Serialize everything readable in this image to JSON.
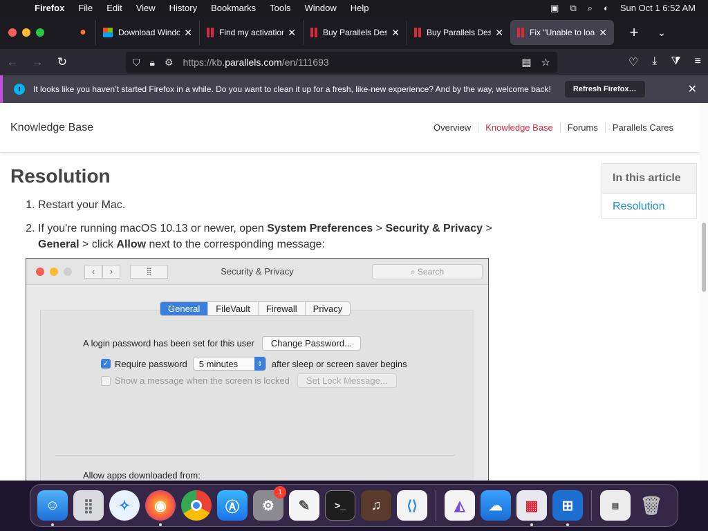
{
  "menubar": {
    "app": "Firefox",
    "items": [
      "File",
      "Edit",
      "View",
      "History",
      "Bookmarks",
      "Tools",
      "Window",
      "Help"
    ],
    "clock": "Sun Oct 1  6:52 AM"
  },
  "tabs": [
    {
      "label": "Download Windows",
      "icon": "microsoft-icon"
    },
    {
      "label": "Find my activation",
      "icon": "parallels-icon"
    },
    {
      "label": "Buy Parallels Desktop",
      "icon": "parallels-icon"
    },
    {
      "label": "Buy Parallels Desktop",
      "icon": "parallels-icon"
    },
    {
      "label": "Fix \"Unable to load",
      "icon": "parallels-icon",
      "active": true
    }
  ],
  "urlbar": {
    "prefix": "https://kb.",
    "domain": "parallels.com",
    "path": "/en/111693"
  },
  "notice": {
    "text": "It looks like you haven’t started Firefox in a while. Do you want to clean it up for a fresh, like-new experience? And by the way, welcome back!",
    "button": "Refresh Firefox…"
  },
  "kb": {
    "brand": "Knowledge Base",
    "nav": [
      "Overview",
      "Knowledge Base",
      "Forums",
      "Parallels Cares"
    ],
    "current_nav": "Knowledge Base"
  },
  "article": {
    "heading": "Resolution",
    "step1": "Restart your Mac.",
    "step2_parts": [
      "If you're running macOS 10.13 or newer, open ",
      "System Preferences",
      " > ",
      "Security & Privacy",
      " > ",
      "General",
      " > click ",
      "Allow",
      " next to the corresponding message:"
    ]
  },
  "toc": {
    "heading": "In this article",
    "link": "Resolution"
  },
  "shot": {
    "title": "Security & Privacy",
    "search_placeholder": "Search",
    "tabs": [
      "General",
      "FileVault",
      "Firewall",
      "Privacy"
    ],
    "active_tab": "General",
    "login_text": "A login password has been set for this user",
    "change_password": "Change Password...",
    "require_password": "Require password",
    "delay": "5 minutes",
    "after_sleep": "after sleep or screen saver begins",
    "show_message": "Show a message when the screen is locked",
    "set_lock": "Set Lock Message...",
    "allow_apps": "Allow apps downloaded from:"
  },
  "dock": {
    "settings_badge": "1"
  },
  "colors": {
    "accent_red": "#d62b3c",
    "link_blue": "#1a8fcf",
    "mac_blue": "#3a7fdc"
  }
}
